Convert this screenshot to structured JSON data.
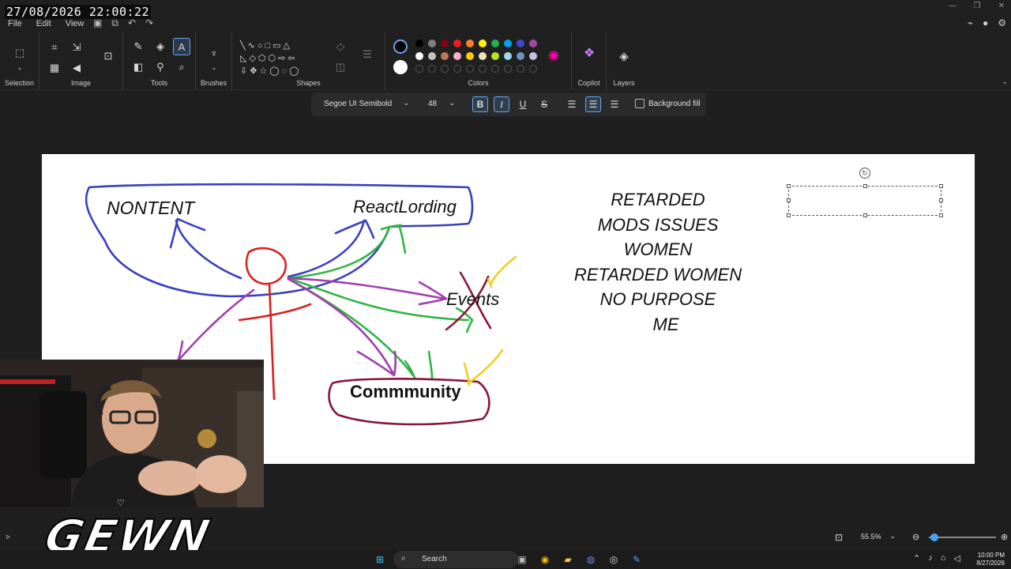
{
  "overlay": {
    "timestamp": "27/08/2026 22:00:22",
    "brand": "GEWN"
  },
  "menu": {
    "file": "File",
    "edit": "Edit",
    "view": "View"
  },
  "ribbon": {
    "groups": {
      "selection": "Selection",
      "image": "Image",
      "tools": "Tools",
      "brushes": "Brushes",
      "shapes": "Shapes",
      "colors": "Colors",
      "copilot": "Copilot",
      "layers": "Layers"
    },
    "palette_row1": [
      "#000000",
      "#7f7f7f",
      "#880015",
      "#ed1c24",
      "#ff7f27",
      "#fff200",
      "#22b14c",
      "#00a2e8",
      "#3f48cc",
      "#a349a4"
    ],
    "palette_row2": [
      "#ffffff",
      "#c3c3c3",
      "#b97a57",
      "#ffaec9",
      "#ffc90e",
      "#efe4b0",
      "#b5e61d",
      "#99d9ea",
      "#7092be",
      "#c8bfe7"
    ],
    "primary_color": "#000000",
    "secondary_color": "#ffffff"
  },
  "textbar": {
    "font": "Segoe UI Semibold",
    "size": "48",
    "bold": "B",
    "italic": "I",
    "underline": "U",
    "strike": "S",
    "background_fill": "Background fill"
  },
  "canvas": {
    "labels": {
      "nontent": "NONTENT",
      "reactlording": "ReactLording",
      "events": "Events",
      "community": "Commmunity"
    },
    "list": [
      "RETARDED",
      "MODS ISSUES",
      "WOMEN",
      "RETARDED WOMEN",
      "NO PURPOSE",
      "ME"
    ]
  },
  "status": {
    "zoom": "55.5%",
    "zoom_fraction": 0.08
  },
  "taskbar": {
    "search": "Search",
    "time": "10:00 PM",
    "date": "8/27/2026"
  }
}
